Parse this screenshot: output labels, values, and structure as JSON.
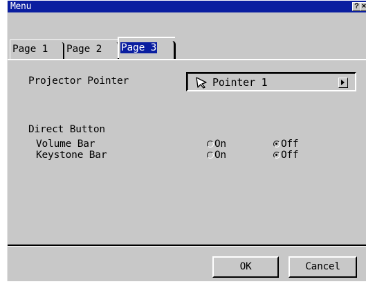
{
  "window": {
    "title": "Menu",
    "help_label": "?",
    "close_label": "×"
  },
  "tabs": [
    {
      "label": "Page 1",
      "selected": false
    },
    {
      "label": "Page 2",
      "selected": false
    },
    {
      "label": "Page 3",
      "selected": true
    }
  ],
  "projector_pointer": {
    "label": "Projector Pointer",
    "selected_value": "Pointer 1",
    "icon": "arrow-pointer-icon"
  },
  "direct_button": {
    "label": "Direct Button",
    "rows": [
      {
        "label": "Volume Bar",
        "on_label": "On",
        "off_label": "Off",
        "value": "Off"
      },
      {
        "label": "Keystone Bar",
        "on_label": "On",
        "off_label": "Off",
        "value": "Off"
      }
    ]
  },
  "footer": {
    "ok_label": "OK",
    "cancel_label": "Cancel"
  },
  "colors": {
    "titlebar": "#0a1ea0",
    "dialog_bg": "#c8c8c8",
    "selected_tab_highlight": "#0a1ea0"
  }
}
